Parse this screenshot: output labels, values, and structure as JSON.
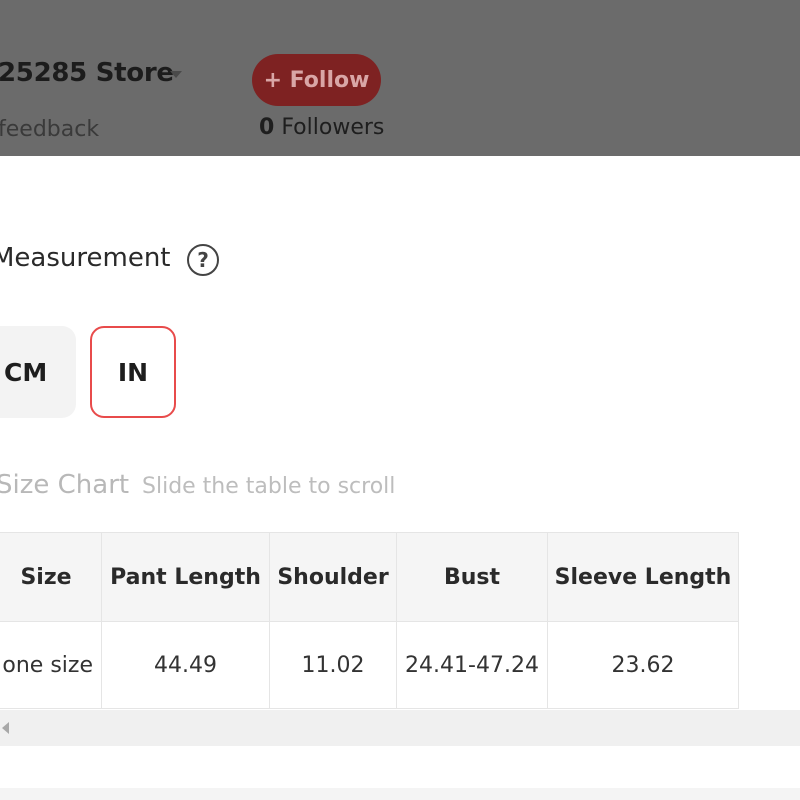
{
  "header": {
    "store_name": "25285 Store",
    "feedback_label": "feedback",
    "follow_label": "+ Follow",
    "followers_count": "0",
    "followers_label": "Followers"
  },
  "measurement": {
    "title": "Measurement",
    "help_icon": "?",
    "units": [
      {
        "label": "CM",
        "selected": false
      },
      {
        "label": "IN",
        "selected": true
      }
    ]
  },
  "size_chart": {
    "title": "Size Chart",
    "hint": "Slide the table to scroll",
    "columns": [
      "Size",
      "Pant Length",
      "Shoulder",
      "Bust",
      "Sleeve Length"
    ],
    "rows": [
      [
        "one size",
        "44.49",
        "11.02",
        "24.41-47.24",
        "23.62"
      ]
    ]
  },
  "colors": {
    "accent": "#e84b4b",
    "header_overlay": "#6b6b6b"
  }
}
